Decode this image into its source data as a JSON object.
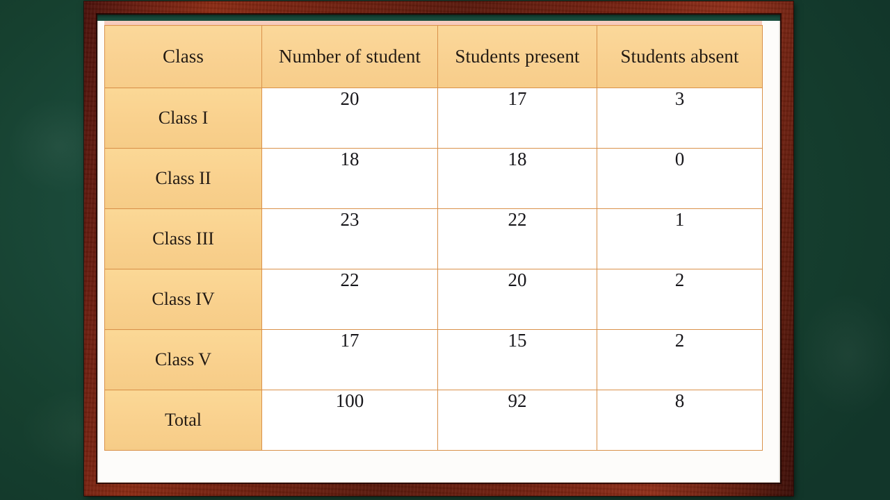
{
  "scene": {
    "background_color": "#16402f",
    "frame_color": "#7b2411",
    "mat_color": "#fdfcfa"
  },
  "table": {
    "header_bg": "#f9d191",
    "cell_bg": "#ffffff",
    "border_color": "#d9914a",
    "top_strip_color": "#f6c9bb",
    "columns": [
      "Class",
      "Number of student",
      "Students present",
      "Students absent"
    ],
    "rows": [
      {
        "label": "Class I",
        "number": "20",
        "present": "17",
        "absent": "3"
      },
      {
        "label": "Class II",
        "number": "18",
        "present": "18",
        "absent": "0"
      },
      {
        "label": "Class III",
        "number": "23",
        "present": "22",
        "absent": "1"
      },
      {
        "label": "Class IV",
        "number": "22",
        "present": "20",
        "absent": "2"
      },
      {
        "label": "Class V",
        "number": "17",
        "present": "15",
        "absent": "2"
      },
      {
        "label": "Total",
        "number": "100",
        "present": "92",
        "absent": "8"
      }
    ]
  },
  "chart_data": {
    "type": "table",
    "title": "",
    "columns": [
      "Class",
      "Number of student",
      "Students present",
      "Students absent"
    ],
    "categories": [
      "Class I",
      "Class II",
      "Class III",
      "Class IV",
      "Class V",
      "Total"
    ],
    "series": [
      {
        "name": "Number of student",
        "values": [
          20,
          18,
          23,
          22,
          17,
          100
        ]
      },
      {
        "name": "Students present",
        "values": [
          17,
          18,
          22,
          20,
          15,
          92
        ]
      },
      {
        "name": "Students absent",
        "values": [
          3,
          0,
          1,
          2,
          2,
          8
        ]
      }
    ]
  }
}
